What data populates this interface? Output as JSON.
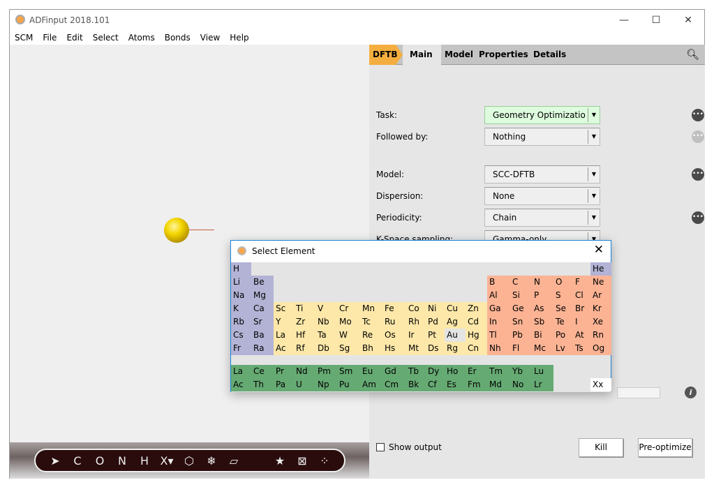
{
  "window": {
    "title": "ADFinput 2018.101",
    "controls": [
      "—",
      "☐",
      "✕"
    ]
  },
  "menu": [
    "SCM",
    "File",
    "Edit",
    "Select",
    "Atoms",
    "Bonds",
    "View",
    "Help"
  ],
  "toolbar": {
    "items": [
      "➤",
      "C",
      "O",
      "N",
      "H",
      "X▾",
      "⬡",
      "❄",
      "▱"
    ],
    "right": [
      "★",
      "⊠",
      "⁘"
    ]
  },
  "panel": {
    "breadcrumb": "DFTB",
    "tabs": [
      "Main",
      "Model",
      "Properties",
      "Details"
    ],
    "rows": [
      {
        "label": "Task:",
        "value": "Geometry Optimizatio",
        "more": "enabled"
      },
      {
        "label": "Followed by:",
        "value": "Nothing",
        "more": "disabled"
      },
      {
        "label": "Model:",
        "value": "SCC-DFTB",
        "more": "enabled"
      },
      {
        "label": "Dispersion:",
        "value": "None"
      },
      {
        "label": "Periodicity:",
        "value": "Chain",
        "more": "enabled"
      },
      {
        "label": "K-Space sampling:",
        "value": "Gamma-only"
      }
    ],
    "show_output": "Show output",
    "show_output_checked": false,
    "kill": "Kill",
    "preoptimize": "Pre-optimize"
  },
  "dialog": {
    "title": "Select Element",
    "selected": "Au",
    "colors": {
      "s": "#b3b3d6",
      "d": "#fde8a9",
      "p": "#fbb394",
      "f": "#66aa73",
      "sel": "#e4e4e4",
      "x": "#ffffff"
    },
    "table": [
      [
        "H",
        "",
        "",
        "",
        "",
        "",
        "",
        "",
        "",
        "",
        "",
        "",
        "",
        "",
        "",
        "",
        "",
        "He"
      ],
      [
        "Li",
        "Be",
        "",
        "",
        "",
        "",
        "",
        "",
        "",
        "",
        "",
        "",
        "B",
        "C",
        "N",
        "O",
        "F",
        "Ne"
      ],
      [
        "Na",
        "Mg",
        "",
        "",
        "",
        "",
        "",
        "",
        "",
        "",
        "",
        "",
        "Al",
        "Si",
        "P",
        "S",
        "Cl",
        "Ar"
      ],
      [
        "K",
        "Ca",
        "Sc",
        "Ti",
        "V",
        "Cr",
        "Mn",
        "Fe",
        "Co",
        "Ni",
        "Cu",
        "Zn",
        "Ga",
        "Ge",
        "As",
        "Se",
        "Br",
        "Kr"
      ],
      [
        "Rb",
        "Sr",
        "Y",
        "Zr",
        "Nb",
        "Mo",
        "Tc",
        "Ru",
        "Rh",
        "Pd",
        "Ag",
        "Cd",
        "In",
        "Sn",
        "Sb",
        "Te",
        "I",
        "Xe"
      ],
      [
        "Cs",
        "Ba",
        "La",
        "Hf",
        "Ta",
        "W",
        "Re",
        "Os",
        "Ir",
        "Pt",
        "Au",
        "Hg",
        "Tl",
        "Pb",
        "Bi",
        "Po",
        "At",
        "Rn"
      ],
      [
        "Fr",
        "Ra",
        "Ac",
        "Rf",
        "Db",
        "Sg",
        "Bh",
        "Hs",
        "Mt",
        "Ds",
        "Rg",
        "Cn",
        "Nh",
        "Fl",
        "Mc",
        "Lv",
        "Ts",
        "Og"
      ]
    ],
    "f_block": [
      [
        "La",
        "Ce",
        "Pr",
        "Nd",
        "Pm",
        "Sm",
        "Eu",
        "Gd",
        "Tb",
        "Dy",
        "Ho",
        "Er",
        "Tm",
        "Yb",
        "Lu"
      ],
      [
        "Ac",
        "Th",
        "Pa",
        "U",
        "Np",
        "Pu",
        "Am",
        "Cm",
        "Bk",
        "Cf",
        "Es",
        "Fm",
        "Md",
        "No",
        "Lr"
      ]
    ],
    "dummy": "Xx"
  }
}
